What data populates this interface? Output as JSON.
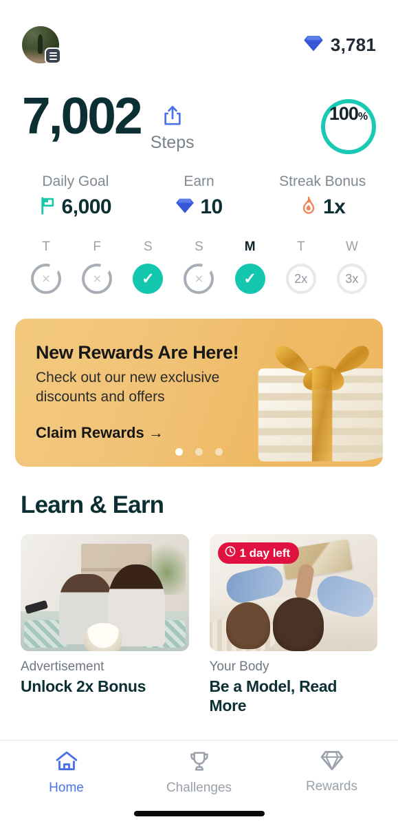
{
  "header": {
    "avatar_name": "user-avatar",
    "menu_badge": "hamburger-menu-badge",
    "gem_icon": "diamond-icon",
    "gem_count": "3,781"
  },
  "hero": {
    "steps_value": "7,002",
    "steps_label": "Steps",
    "share_icon": "share-icon",
    "progress_value": "100",
    "progress_symbol": "%",
    "ring_color": "#1ac9b4"
  },
  "stats": [
    {
      "caption": "Daily Goal",
      "value": "6,000",
      "icon": "flag-icon",
      "icon_color": "#17c9a9"
    },
    {
      "caption": "Earn",
      "value": "10",
      "icon": "diamond-icon",
      "icon_color": "#3b5fe0"
    },
    {
      "caption": "Streak Bonus",
      "value": "1x",
      "icon": "flame-icon",
      "icon_color": "#f08458"
    }
  ],
  "week": [
    {
      "day": "T",
      "state": "missed",
      "mark": "×",
      "active": false
    },
    {
      "day": "F",
      "state": "missed",
      "mark": "×",
      "active": false
    },
    {
      "day": "S",
      "state": "completed",
      "mark": "✓",
      "active": false
    },
    {
      "day": "S",
      "state": "missed",
      "mark": "×",
      "active": false
    },
    {
      "day": "M",
      "state": "completed",
      "mark": "✓",
      "active": true
    },
    {
      "day": "T",
      "state": "multiplier",
      "mark": "2x",
      "active": false
    },
    {
      "day": "W",
      "state": "multiplier",
      "mark": "3x",
      "active": false
    }
  ],
  "promo": {
    "title": "New Rewards Are Here!",
    "body": "Check out our new exclusive discounts and offers",
    "cta": "Claim Rewards →",
    "image": "gift-box-image",
    "dots_total": 3,
    "dots_active_index": 0,
    "bg_color": "#eeb963"
  },
  "learn": {
    "section_title": "Learn & Earn",
    "cards": [
      {
        "kicker": "Advertisement",
        "title": "Unlock 2x Bonus",
        "image": "couple-watching-tv-image",
        "badge": null
      },
      {
        "kicker": "Your Body",
        "title": "Be a Model, Read More",
        "image": "people-reading-book-image",
        "badge": {
          "icon": "clock-icon",
          "text": "1 day left",
          "color": "#e01340"
        }
      }
    ]
  },
  "nav": {
    "items": [
      {
        "label": "Home",
        "icon": "home-icon",
        "active": true
      },
      {
        "label": "Challenges",
        "icon": "trophy-icon",
        "active": false
      },
      {
        "label": "Rewards",
        "icon": "diamond-icon",
        "active": false
      }
    ],
    "active_color": "#4a72e8",
    "inactive_color": "#9aa1a9"
  }
}
